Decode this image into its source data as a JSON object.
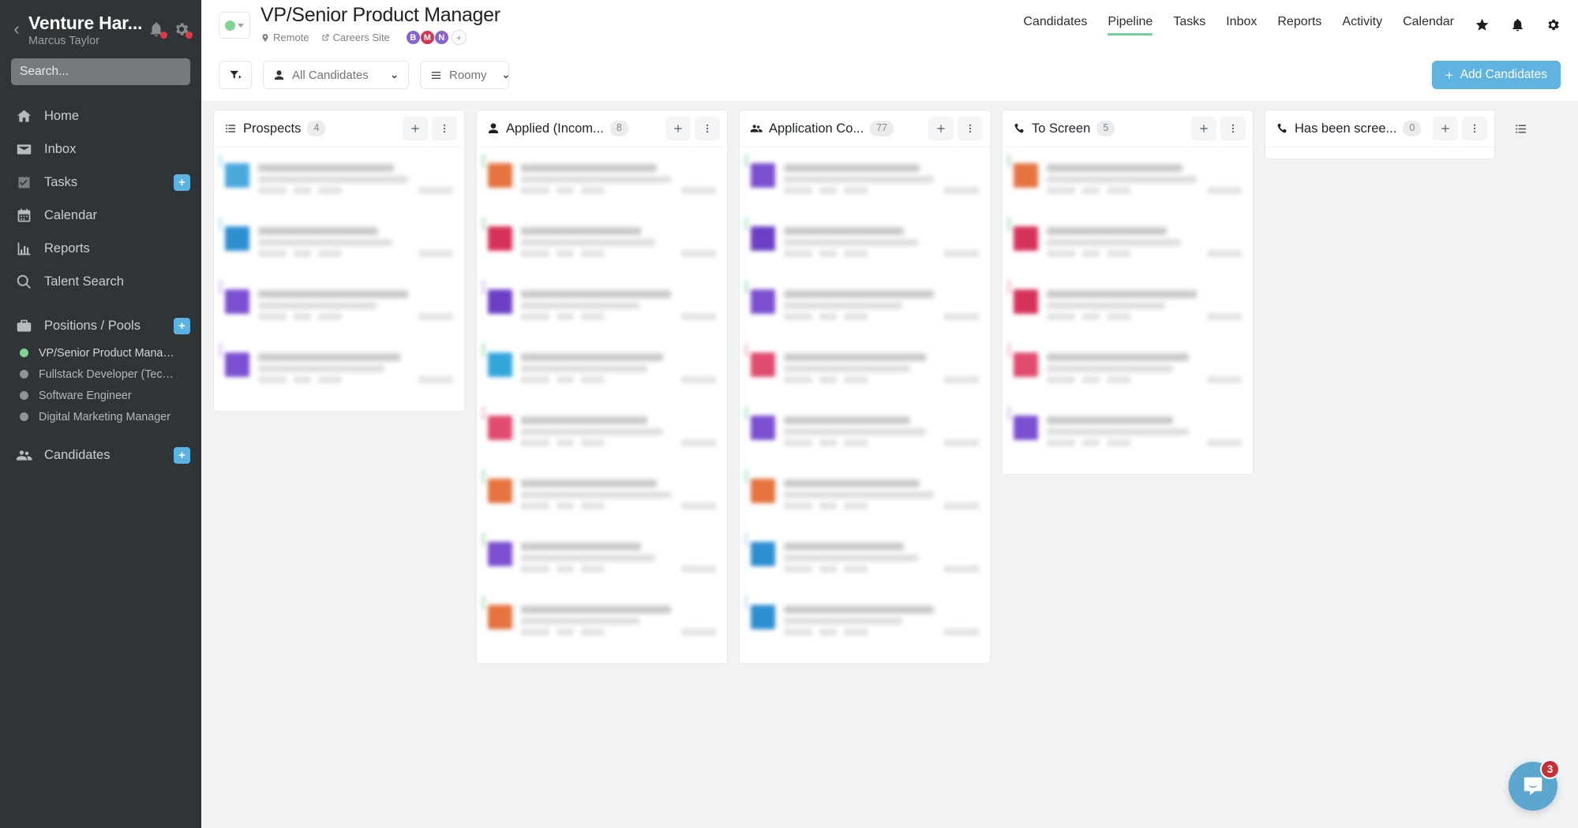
{
  "sidebar": {
    "back_icon": "chevron-left-icon",
    "org_name": "Venture Har...",
    "user_name": "Marcus Taylor",
    "bell_icon": "bell-icon",
    "gear_icon": "gear-icon",
    "search_placeholder": "Search...",
    "search_value": "",
    "nav": [
      {
        "label": "Home",
        "icon": "home-icon",
        "badge": ""
      },
      {
        "label": "Inbox",
        "icon": "envelope-icon",
        "badge": ""
      },
      {
        "label": "Tasks",
        "icon": "checkbox-icon",
        "badge": "+"
      },
      {
        "label": "Calendar",
        "icon": "calendar-icon",
        "badge": ""
      },
      {
        "label": "Reports",
        "icon": "bar-chart-icon",
        "badge": ""
      },
      {
        "label": "Talent Search",
        "icon": "magnifier-icon",
        "badge": ""
      }
    ],
    "positions_group": {
      "label": "Positions / Pools",
      "icon": "briefcase-icon",
      "badge": "+",
      "items": [
        {
          "label": "VP/Senior Product Manager",
          "status_color": "#7ed492",
          "active": true
        },
        {
          "label": "Fullstack Developer (Tech...",
          "status_color": "#8e959a",
          "active": false
        },
        {
          "label": "Software Engineer",
          "status_color": "#8e959a",
          "active": false
        },
        {
          "label": "Digital Marketing Manager",
          "status_color": "#8e959a",
          "active": false
        }
      ]
    },
    "candidates_group": {
      "label": "Candidates",
      "icon": "people-icon",
      "badge": "+"
    }
  },
  "header": {
    "status_color": "#7ed492",
    "status_caret": "chevron-down-icon",
    "title": "VP/Senior Product Manager",
    "meta": [
      {
        "label": "Remote",
        "icon": "location-pin-icon"
      },
      {
        "label": "Careers Site",
        "icon": "external-link-icon"
      }
    ],
    "avatars": [
      {
        "initial": "B",
        "color": "#8a63d2"
      },
      {
        "initial": "M",
        "color": "#d63450"
      },
      {
        "initial": "N",
        "color": "#8a63d2"
      }
    ],
    "avatar_add": "+",
    "nav": [
      {
        "label": "Candidates",
        "active": false
      },
      {
        "label": "Pipeline",
        "active": true
      },
      {
        "label": "Tasks",
        "active": false
      },
      {
        "label": "Inbox",
        "active": false
      },
      {
        "label": "Reports",
        "active": false
      },
      {
        "label": "Activity",
        "active": false
      },
      {
        "label": "Calendar",
        "active": false
      }
    ],
    "icons": [
      {
        "name": "star-icon"
      },
      {
        "name": "bell-icon"
      },
      {
        "name": "gear-icon"
      }
    ],
    "active_underline_color": "#6fcf97"
  },
  "toolbar": {
    "filter_icon": "filter-icon",
    "audience_select": {
      "icon": "person-icon",
      "value": "All Candidates",
      "caret": "chevron-down-icon"
    },
    "density_select": {
      "icon": "list-icon",
      "value": "Roomy",
      "caret": "chevron-down-icon"
    },
    "add_button": {
      "label": "Add Candidates",
      "plus": "+",
      "color": "#5fb3e0"
    }
  },
  "board": {
    "columns": [
      {
        "name": "Prospects",
        "icon": "list-icon",
        "count": "4",
        "add_icon": "plus-icon",
        "more_icon": "kebab-icon",
        "cards": [
          {
            "stripe": "#bfe6f7",
            "avatar": "#4aa8dd"
          },
          {
            "stripe": "#bfe6f7",
            "avatar": "#2e8fd0"
          },
          {
            "stripe": "#d9ccf2",
            "avatar": "#7b4fd1"
          },
          {
            "stripe": "#d9ccf2",
            "avatar": "#7b4fd1"
          }
        ]
      },
      {
        "name": "Applied (Incom...",
        "icon": "person-icon",
        "count": "8",
        "add_icon": "plus-icon",
        "more_icon": "kebab-icon",
        "cards": [
          {
            "stripe": "#b9e6c6",
            "avatar": "#e5733f"
          },
          {
            "stripe": "#b9e6c6",
            "avatar": "#d6315a"
          },
          {
            "stripe": "#d9ccf2",
            "avatar": "#6b3fc4"
          },
          {
            "stripe": "#b9e6c6",
            "avatar": "#33a6dc"
          },
          {
            "stripe": "#f5c2cd",
            "avatar": "#e14b6f"
          },
          {
            "stripe": "#b9e6c6",
            "avatar": "#e5733f"
          },
          {
            "stripe": "#b9e6c6",
            "avatar": "#7b4fd1"
          },
          {
            "stripe": "#b9e6c6",
            "avatar": "#e5733f"
          }
        ]
      },
      {
        "name": "Application Co...",
        "icon": "people-icon",
        "count": "77",
        "add_icon": "plus-icon",
        "more_icon": "kebab-icon",
        "cards": [
          {
            "stripe": "#b9e6c6",
            "avatar": "#7b4fd1"
          },
          {
            "stripe": "#b9e6c6",
            "avatar": "#6b3fc4"
          },
          {
            "stripe": "#b9e6c6",
            "avatar": "#7b4fd1"
          },
          {
            "stripe": "#f5c2cd",
            "avatar": "#e14b6f"
          },
          {
            "stripe": "#b9e6c6",
            "avatar": "#7b4fd1"
          },
          {
            "stripe": "#b9e6c6",
            "avatar": "#e5733f"
          },
          {
            "stripe": "#cfe8f7",
            "avatar": "#2e8fd0"
          },
          {
            "stripe": "#cfe8f7",
            "avatar": "#2e8fd0"
          }
        ]
      },
      {
        "name": "To Screen",
        "icon": "phone-icon",
        "count": "5",
        "add_icon": "plus-icon",
        "more_icon": "kebab-icon",
        "cards": [
          {
            "stripe": "#b9e6c6",
            "avatar": "#e5733f"
          },
          {
            "stripe": "#b9e6c6",
            "avatar": "#d6315a"
          },
          {
            "stripe": "#f5c2cd",
            "avatar": "#d6315a"
          },
          {
            "stripe": "#f5c2cd",
            "avatar": "#e14b6f"
          },
          {
            "stripe": "#d9ccf2",
            "avatar": "#7b4fd1"
          }
        ]
      },
      {
        "name": "Has been scree...",
        "icon": "phone-icon",
        "count": "0",
        "add_icon": "plus-icon",
        "more_icon": "kebab-icon",
        "cards": []
      }
    ],
    "rail_icon": "list-icon"
  },
  "chat": {
    "icon": "chat-bubble-icon",
    "badge": "3",
    "color": "#5ba7cf"
  }
}
